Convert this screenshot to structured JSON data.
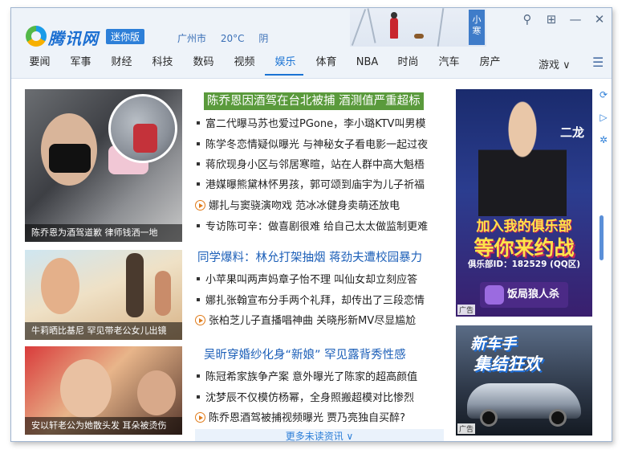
{
  "header": {
    "brand": "腾讯网",
    "badge": "迷你版",
    "weather": {
      "city": "广州市",
      "temp": "20°C",
      "condition": "阴"
    },
    "scene_term": "小寒"
  },
  "nav": {
    "items": [
      "要闻",
      "军事",
      "财经",
      "科技",
      "数码",
      "视频",
      "娱乐",
      "体育",
      "NBA",
      "时尚",
      "汽车",
      "房产"
    ],
    "active": "娱乐",
    "more": "游戏 ∨"
  },
  "thumbs": [
    {
      "caption": "陈乔恩为酒驾道歉 律师钱洒一地"
    },
    {
      "caption": "牛莉晒比基尼 罕见带老公女儿出镜"
    },
    {
      "caption": "安以轩老公为她散头发 耳朵被烫伤"
    }
  ],
  "sections": [
    {
      "headline": "陈乔恩因酒驾在台北被捕 酒测值严重超标",
      "items": [
        {
          "text": "富二代曝马苏也爱过PGone，李小璐KTV叫男模",
          "type": "text"
        },
        {
          "text": "陈学冬恋情疑似曝光 与神秘女子看电影一起过夜",
          "type": "text"
        },
        {
          "text": "蒋欣现身小区与邻居寒暄，站在人群中高大魁梧",
          "type": "text"
        },
        {
          "text": "港媒曝熊黛林怀男孩，郭可颂到庙宇为儿子祈福",
          "type": "text"
        },
        {
          "text": "娜扎与窦骁演吻戏 范冰冰健身卖萌还放电",
          "type": "video"
        },
        {
          "text": "专访陈可辛：做喜剧很难 给自己太太做监制更难",
          "type": "text"
        }
      ]
    },
    {
      "headline": "同学爆料：林允打架抽烟 蒋劲夫遭校园暴力",
      "items": [
        {
          "text": "小苹果叫两声妈章子怡不理 叫仙女却立刻应答",
          "type": "text"
        },
        {
          "text": "娜扎张翰宣布分手两个礼拜，却传出了三段恋情",
          "type": "text"
        },
        {
          "text": "张柏芝儿子直播唱神曲 关晓彤新MV尽显尴尬",
          "type": "video"
        }
      ]
    },
    {
      "headline": "吴昕穿婚纱化身“新娘” 罕见露背秀性感",
      "items": [
        {
          "text": "陈冠希家族争产案 意外曝光了陈家的超高颜值",
          "type": "text"
        },
        {
          "text": "沈梦辰不仅模仿杨幂，全身照搬超模对比惨烈",
          "type": "text"
        },
        {
          "text": "陈乔恩酒驾被捕视频曝光 贾乃亮独自买醉?",
          "type": "video"
        }
      ]
    }
  ],
  "more_link": "更多未读资讯 ∨",
  "ads": {
    "ad1": {
      "tag": "二龙",
      "line1": "加入我的俱乐部",
      "line2": "等你来约战",
      "line3": "俱乐部ID：182529 (QQ区)",
      "game": "饭局狼人杀",
      "label": "广告"
    },
    "ad2": {
      "line1": "新车手",
      "line2": "集结狂欢",
      "label": "广告"
    }
  }
}
